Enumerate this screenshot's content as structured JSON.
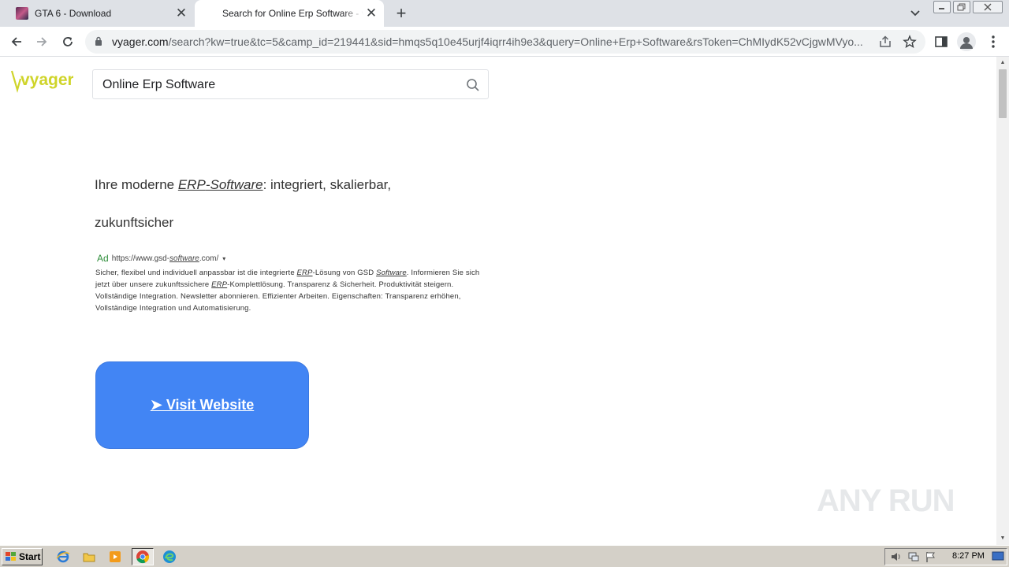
{
  "browser": {
    "tabs": [
      {
        "title": "GTA 6 - Download",
        "active": false,
        "favicon": "gta-favicon-icon"
      },
      {
        "title": "Search for Online Erp Software - vyager",
        "active": true,
        "favicon": "none"
      }
    ],
    "url_host": "vyager.com",
    "url_rest": "/search?kw=true&tc=5&camp_id=219441&sid=hmqs5q10e45urjf4iqrr4ih9e3&query=Online+Erp+Software&rsToken=ChMIydK52vCjgwMVyo..."
  },
  "page": {
    "logo_text": "vyager",
    "logo_color": "#cfd42a",
    "search_value": "Online Erp Software",
    "headline": {
      "pre": "Ihre moderne ",
      "kw1": "ERP",
      "dash": "-",
      "kw2": "Software",
      "post": ": integriert, skalierbar, zukunftsicher"
    },
    "ad": {
      "badge": "Ad",
      "url_pre": "https://www.gsd-",
      "url_kw": "software",
      "url_post": ".com/",
      "caret": "▾",
      "desc_1": "Sicher, flexibel und individuell anpassbar ist die integrierte ",
      "desc_kw1": "ERP",
      "desc_2": "-Lösung von GSD ",
      "desc_kw2": "Software",
      "desc_3": ". Informieren Sie sich jetzt über unsere zukunftssichere ",
      "desc_kw3": "ERP",
      "desc_4": "-Komplettlösung. Transparenz & Sicherheit. Produktivität steigern. Vollständige Integration. Newsletter abonnieren. Effizienter Arbeiten. Eigenschaften: Transparenz erhöhen, Vollständige Integration und Automatisierung."
    },
    "visit_button": "➤ Visit Website",
    "button_color": "#4285f4",
    "watermark": "ANY RUN"
  },
  "taskbar": {
    "start_label": "Start",
    "clock": "8:27 PM",
    "apps": [
      "ie-icon",
      "explorer-icon",
      "media-player-icon",
      "chrome-icon",
      "edge-icon"
    ]
  }
}
